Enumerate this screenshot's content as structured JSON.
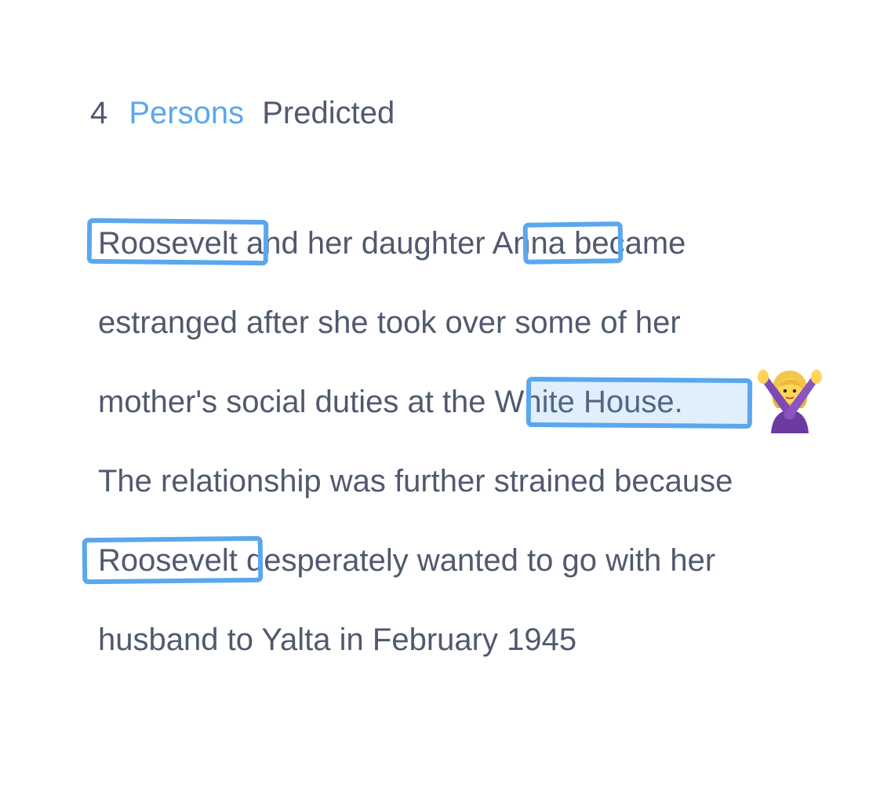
{
  "header": {
    "count": "4",
    "entity_type": "Persons",
    "suffix": "Predicted"
  },
  "passage": {
    "lines": [
      [
        "Roosevelt ",
        "and her daughter ",
        "Anna",
        " became"
      ],
      [
        "estranged after she took over some of her"
      ],
      [
        "mother's social duties at the ",
        "White House."
      ],
      [
        "The relationship was further strained because"
      ],
      [
        "Roosevelt",
        " desperately wanted to go with her"
      ],
      [
        "husband to Yalta in February 1945"
      ]
    ],
    "predicted_entities": [
      "Roosevelt",
      "Anna",
      "White House.",
      "Roosevelt"
    ],
    "rejected_entity": "White House."
  },
  "reject_icon": "person-gesturing-no-icon",
  "colors": {
    "accent": "#5aa7ee",
    "text": "#505a6e"
  }
}
